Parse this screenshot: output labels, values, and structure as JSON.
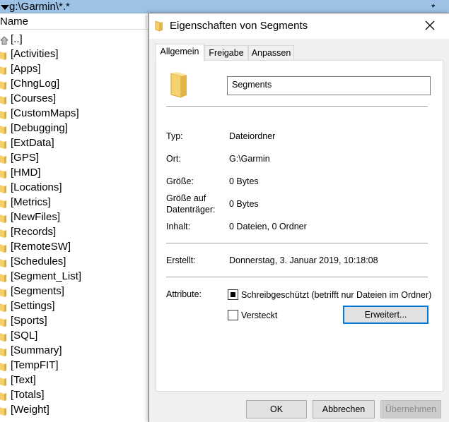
{
  "file_manager": {
    "path": "g:\\Garmin\\*.*",
    "path_suffix": "*",
    "column_name": "Name",
    "items": [
      {
        "label": "[..]",
        "icon": "up-folder"
      },
      {
        "label": "[Activities]",
        "icon": "folder"
      },
      {
        "label": "[Apps]",
        "icon": "folder"
      },
      {
        "label": "[ChngLog]",
        "icon": "folder"
      },
      {
        "label": "[Courses]",
        "icon": "folder"
      },
      {
        "label": "[CustomMaps]",
        "icon": "folder"
      },
      {
        "label": "[Debugging]",
        "icon": "folder"
      },
      {
        "label": "[ExtData]",
        "icon": "folder"
      },
      {
        "label": "[GPS]",
        "icon": "folder"
      },
      {
        "label": "[HMD]",
        "icon": "folder"
      },
      {
        "label": "[Locations]",
        "icon": "folder"
      },
      {
        "label": "[Metrics]",
        "icon": "folder"
      },
      {
        "label": "[NewFiles]",
        "icon": "folder"
      },
      {
        "label": "[Records]",
        "icon": "folder"
      },
      {
        "label": "[RemoteSW]",
        "icon": "folder"
      },
      {
        "label": "[Schedules]",
        "icon": "folder"
      },
      {
        "label": "[Segment_List]",
        "icon": "folder"
      },
      {
        "label": "[Segments]",
        "icon": "folder"
      },
      {
        "label": "[Settings]",
        "icon": "folder"
      },
      {
        "label": "[Sports]",
        "icon": "folder"
      },
      {
        "label": "[SQL]",
        "icon": "folder"
      },
      {
        "label": "[Summary]",
        "icon": "folder"
      },
      {
        "label": "[TempFIT]",
        "icon": "folder"
      },
      {
        "label": "[Text]",
        "icon": "folder"
      },
      {
        "label": "[Totals]",
        "icon": "folder"
      },
      {
        "label": "[Weight]",
        "icon": "folder"
      }
    ]
  },
  "dialog": {
    "title": "Eigenschaften von Segments",
    "tabs": [
      {
        "label": "Allgemein",
        "active": true
      },
      {
        "label": "Freigabe",
        "active": false
      },
      {
        "label": "Anpassen",
        "active": false
      }
    ],
    "name_value": "Segments",
    "fields": {
      "typ_label": "Typ:",
      "typ_value": "Dateiordner",
      "ort_label": "Ort:",
      "ort_value": "G:\\Garmin",
      "groesse_label": "Größe:",
      "groesse_value": "0 Bytes",
      "groesse_dt_label_1": "Größe auf",
      "groesse_dt_label_2": "Datenträger:",
      "groesse_dt_value": "0 Bytes",
      "inhalt_label": "Inhalt:",
      "inhalt_value": "0 Dateien, 0 Ordner",
      "erstellt_label": "Erstellt:",
      "erstellt_value": "Donnerstag, 3. Januar 2019, 10:18:08",
      "attribute_label": "Attribute:"
    },
    "attributes": {
      "readonly_label": "Schreibgeschützt (betrifft nur Dateien im Ordner)",
      "readonly_state": "indeterminate",
      "hidden_label": "Versteckt",
      "hidden_state": "unchecked",
      "advanced_button": "Erweitert..."
    },
    "buttons": {
      "ok": "OK",
      "cancel": "Abbrechen",
      "apply": "Übernehmen"
    },
    "colors": {
      "folder_yellow": "#f4cf6a",
      "folder_dark": "#dcae3c",
      "accent": "#0078d7",
      "path_bar": "#9dc2e6"
    }
  }
}
